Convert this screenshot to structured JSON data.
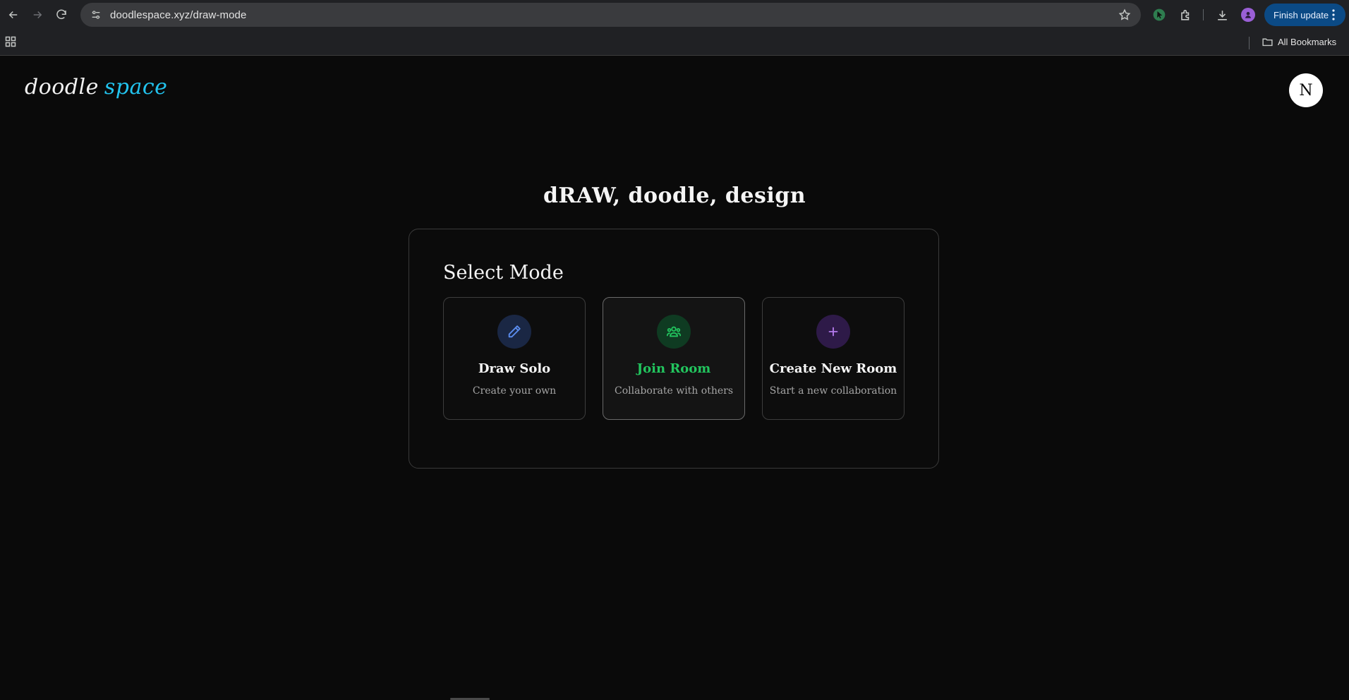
{
  "browser": {
    "url": "doodlespace.xyz/draw-mode",
    "update_label": "Finish update",
    "bookmarks_label": "All Bookmarks",
    "icons": [
      "back-icon",
      "forward-icon",
      "reload-icon",
      "site-settings-icon",
      "star-icon",
      "extension-pointer-icon",
      "extensions-icon",
      "download-icon",
      "profile-icon",
      "menu-dots-icon",
      "apps-icon",
      "folder-icon"
    ]
  },
  "header": {
    "logo_word1": "doodle",
    "logo_word2": "space",
    "avatar_initial": "N",
    "accent_color": "#22c3ee"
  },
  "hero": {
    "headline": "dRAW, doodle, design"
  },
  "mode_panel": {
    "title": "Select Mode",
    "modes": [
      {
        "name": "Draw Solo",
        "description": "Create your own",
        "icon": "pencil-icon",
        "color": "#5b8def",
        "bg": "#1a2744"
      },
      {
        "name": "Join Room",
        "description": "Collaborate with others",
        "icon": "users-icon",
        "color": "#22c55e",
        "bg": "#0f3b22",
        "active": true
      },
      {
        "name": "Create New Room",
        "description": "Start a new collaboration",
        "icon": "plus-icon",
        "color": "#b57bee",
        "bg": "#2e1a48"
      }
    ]
  }
}
